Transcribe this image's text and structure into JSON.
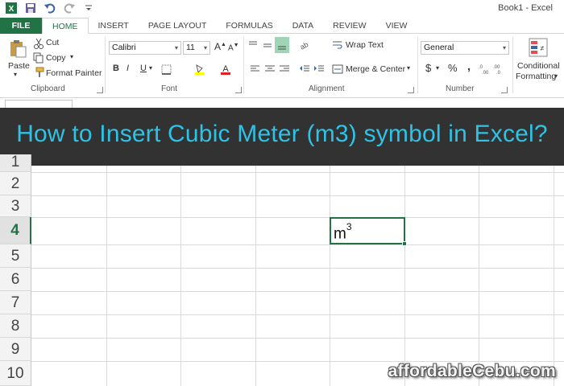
{
  "window": {
    "title": "Book1 - Excel"
  },
  "ribbon_tabs": [
    "FILE",
    "HOME",
    "INSERT",
    "PAGE LAYOUT",
    "FORMULAS",
    "DATA",
    "REVIEW",
    "VIEW"
  ],
  "clipboard": {
    "paste": "Paste",
    "cut": "Cut",
    "copy": "Copy",
    "format_painter": "Format Painter",
    "label": "Clipboard"
  },
  "font": {
    "name": "Calibri",
    "size": "11",
    "bold": "B",
    "italic": "I",
    "underline": "U",
    "label": "Font"
  },
  "alignment": {
    "wrap_text": "Wrap Text",
    "merge_center": "Merge & Center",
    "label": "Alignment"
  },
  "number": {
    "format": "General",
    "currency": "$",
    "percent": "%",
    "comma": ",",
    "label": "Number"
  },
  "styles": {
    "conditional": "Conditional",
    "formatting": "Formatting"
  },
  "banner": {
    "text": "How to Insert Cubic Meter (m3) symbol in Excel?"
  },
  "grid": {
    "rows": [
      "1",
      "2",
      "3",
      "4",
      "5",
      "6",
      "7",
      "8",
      "9",
      "10"
    ],
    "selected_row": "4",
    "cell_base": "m",
    "cell_superscript": "3"
  },
  "watermark": "affordableCebu.com",
  "colors": {
    "excel_green": "#217346",
    "banner_text": "#2ec3e6"
  },
  "icons": [
    "excel-logo-icon",
    "save-icon",
    "undo-icon",
    "redo-icon",
    "customize-icon",
    "paste-icon",
    "cut-icon",
    "copy-icon",
    "format-painter-icon"
  ]
}
